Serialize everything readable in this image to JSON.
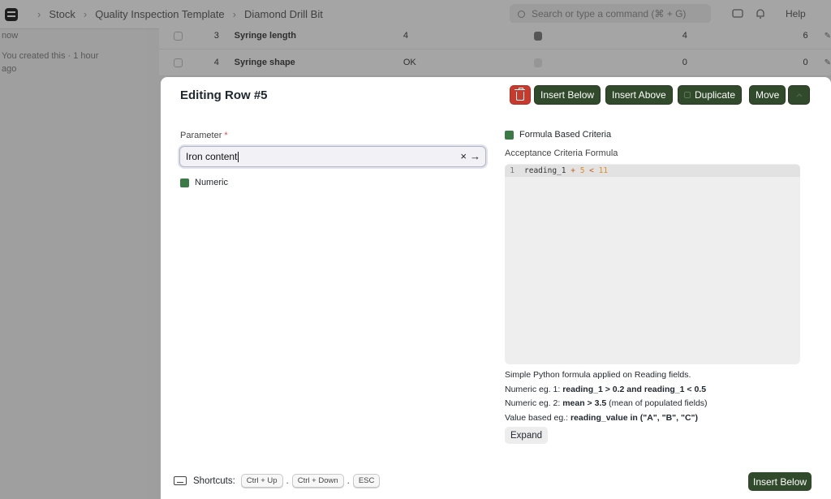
{
  "navbar": {
    "breadcrumbs": [
      "Stock",
      "Quality Inspection Template",
      "Diamond Drill Bit"
    ],
    "search_placeholder": "Search or type a command (⌘ + G)",
    "help_label": "Help"
  },
  "activity": {
    "line_now": "now",
    "created_text": "You created this · 1 hour",
    "created_ago": "ago"
  },
  "background_rows": [
    {
      "index": "3",
      "parameter": "Syringe length",
      "value": "4",
      "numeric_checked": true,
      "min": "4",
      "max": "6"
    },
    {
      "index": "4",
      "parameter": "Syringe shape",
      "value": "OK",
      "numeric_checked": false,
      "min": "0",
      "max": "0"
    }
  ],
  "modal": {
    "title": "Editing Row #5",
    "buttons": {
      "delete_icon": "trash-icon",
      "insert_below": "Insert Below",
      "insert_above": "Insert Above",
      "duplicate": "Duplicate",
      "move": "Move"
    },
    "parameter": {
      "label": "Parameter",
      "required_mark": "*",
      "value": "Iron content"
    },
    "numeric_label": "Numeric",
    "formula_based_label": "Formula Based Criteria",
    "formula": {
      "label": "Acceptance Criteria Formula",
      "line_number": "1",
      "tokens": [
        "reading_1",
        "+",
        "5",
        "<",
        "11"
      ]
    },
    "help": {
      "line1": "Simple Python formula applied on Reading fields.",
      "ex1_prefix": "Numeric eg. 1: ",
      "ex1_code": "reading_1 > 0.2 and reading_1 < 0.5",
      "ex2_prefix": "Numeric eg. 2: ",
      "ex2_code": "mean > 3.5",
      "ex2_suffix": " (mean of populated fields)",
      "ex3_prefix": "Value based eg.: ",
      "ex3_code": "reading_value in (\"A\", \"B\", \"C\")"
    },
    "expand_label": "Expand",
    "footer": {
      "shortcuts_label": "Shortcuts:",
      "keys": [
        "Ctrl + Up",
        "Ctrl + Down",
        "ESC"
      ],
      "insert_below": "Insert Below"
    }
  },
  "colors": {
    "primary": "#314a2c",
    "danger": "#c73a2e",
    "checkbox": "#3b7a46"
  }
}
